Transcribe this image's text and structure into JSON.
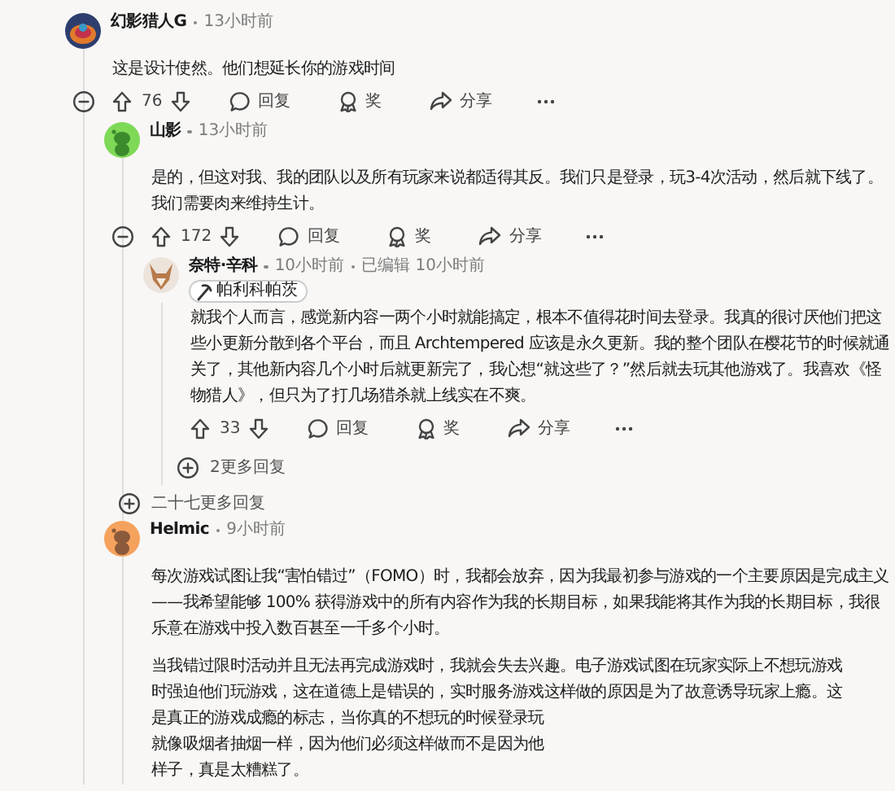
{
  "comments": [
    {
      "author": "幻影猎人G",
      "time": "13小时前",
      "paragraphs": [
        {
          "kind": "text",
          "text": "这是设计使然。他们想延长你的游戏时间"
        }
      ],
      "expanded": true,
      "votes": "76",
      "reply": "回复",
      "award": "奖",
      "share": "分享",
      "children": [
        {
          "author": "山影",
          "time": "13小时前",
          "paragraphs": [
            {
              "kind": "text",
              "text": "是的，但这对我、我的团队以及所有玩家来说都适得其反。我们只是登录，玩3-4次活动，然后就下线了。我们需要肉来维持生计。"
            }
          ],
          "expanded": true,
          "votes": "172",
          "reply": "回复",
          "award": "奖",
          "share": "分享",
          "children": [
            {
              "author": "奈特·辛科",
              "time": "10小时前",
              "edited": "已编辑 10小时前",
              "flair": "帕利科帕茨",
              "paragraphs": [
                {
                  "kind": "text",
                  "text": "就我个人而言，感觉新内容一两个小时就能搞定，根本不值得花时间去登录。我真的很讨厌他们把这些小更新分散到各个平台，而且 Archtempered 应该是永久更新。我的整个团队在樱花节的时候就通关了，其他新内容几个小时后就更新完了，我心想“就这些了？”然后就去玩其他游戏了。我喜欢《怪物猎人》，但只为了打几场猎杀就上线实在不爽。"
                }
              ],
              "votes": "33",
              "reply": "回复",
              "award": "奖",
              "share": "分享",
              "more_replies": "2更多回复"
            }
          ],
          "more_replies": "二十七更多回复"
        },
        {
          "author": "Helmic",
          "time": "9小时前",
          "paragraphs": [
            {
              "kind": "text",
              "text": "每次游戏试图让我“害怕错过”（FOMO）时，我都会放弃，因为我最初参与游戏的一个主要原因是完成主义——我希望能够 100% 获得游戏中的所有内容作为我的长期目标，如果我能将其作为我的长期目标，我很乐意在游戏中投入数百甚至一千多个小时。"
            },
            {
              "kind": "lines",
              "lines": [
                "当我错过限时活动并且无法再完成游戏时，我就会失去兴趣。电子游戏试图在玩家实际上不想玩游戏",
                "时强迫他们玩游戏，这在道德上是错误的，实时服务游戏这样做的原因是为了故意诱导玩家上瘾。这",
                "是真正的游戏成瘾的标志，当你真的不想玩的时候登录玩",
                "就像吸烟者抽烟一样，因为他们必须这样做而不是因为他",
                "样子，真是太糟糕了。"
              ]
            }
          ]
        }
      ]
    }
  ]
}
